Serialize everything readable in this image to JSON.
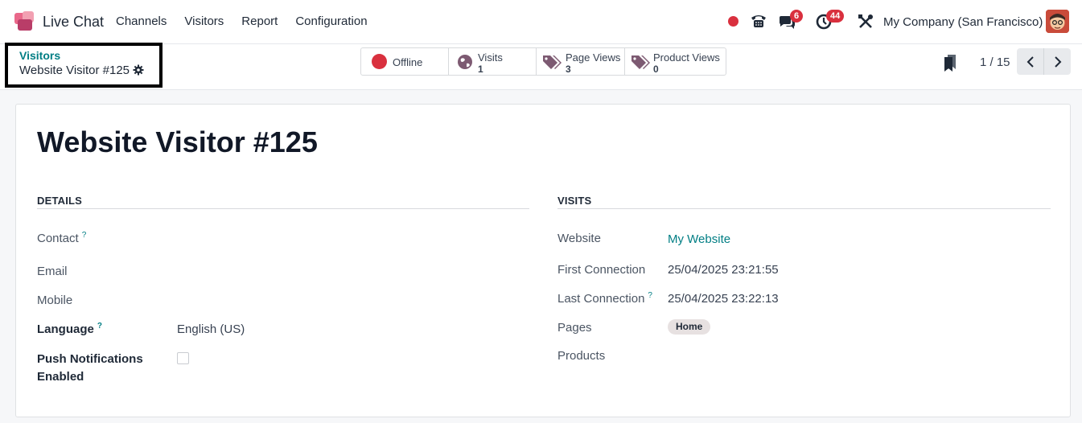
{
  "navbar": {
    "app_name": "Live Chat",
    "menu": [
      "Channels",
      "Visitors",
      "Report",
      "Configuration"
    ],
    "messages_badge": "6",
    "activities_badge": "44",
    "company": "My Company (San Francisco)",
    "colors": {
      "accent": "#017e84",
      "badge": "#d9303e"
    }
  },
  "breadcrumb": {
    "parent": "Visitors",
    "current": "Website Visitor #125"
  },
  "stats": {
    "status_label": "Offline",
    "visits_label": "Visits",
    "visits_value": "1",
    "page_views_label": "Page Views",
    "page_views_value": "3",
    "product_views_label": "Product Views",
    "product_views_value": "0"
  },
  "pager": {
    "text": "1 / 15"
  },
  "record": {
    "title": "Website Visitor #125",
    "details_title": "DETAILS",
    "visits_title": "VISITS",
    "contact_label": "Contact",
    "email_label": "Email",
    "mobile_label": "Mobile",
    "language_label": "Language",
    "language_value": "English (US)",
    "push_label_1": "Push Notifications",
    "push_label_2": "Enabled",
    "website_label": "Website",
    "website_value": "My Website",
    "first_conn_label": "First Connection",
    "first_conn_value": "25/04/2025 23:21:55",
    "last_conn_label": "Last Connection",
    "last_conn_value": "25/04/2025 23:22:13",
    "pages_label": "Pages",
    "pages_tag": "Home",
    "products_label": "Products",
    "help_mark": "?"
  }
}
